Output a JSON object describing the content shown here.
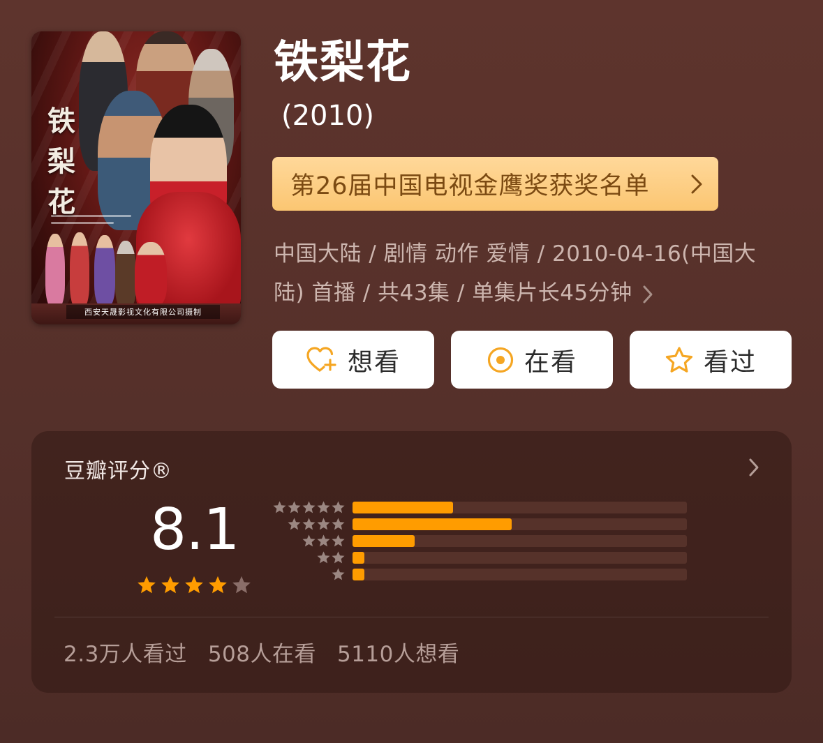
{
  "movie": {
    "title": "铁梨花",
    "year": "(2010)",
    "poster": {
      "title_text": "铁梨花",
      "company": "西安天晟影视文化有限公司摄制"
    }
  },
  "award": {
    "label": "第26届中国电视金鹰奖获奖名单"
  },
  "meta": {
    "line1": "中国大陆 / 剧情 动作 爱情 / 2010-04-16(中国大",
    "line2": "陆) 首播 / 共43集 / 单集片长45分钟"
  },
  "actions": {
    "want": "想看",
    "watching": "在看",
    "watched": "看过"
  },
  "rating": {
    "title": "豆瓣评分®",
    "score": "8.1",
    "star_level": 4,
    "distribution_percent": [
      30,
      47.5,
      18.5,
      3.5,
      3.5
    ]
  },
  "counts": {
    "watched": "2.3万人看过",
    "watching": "508人在看",
    "want": "5110人想看"
  },
  "colors": {
    "accent": "#ff9c00",
    "award_text": "#7b4a12",
    "background": "#5a322b"
  }
}
